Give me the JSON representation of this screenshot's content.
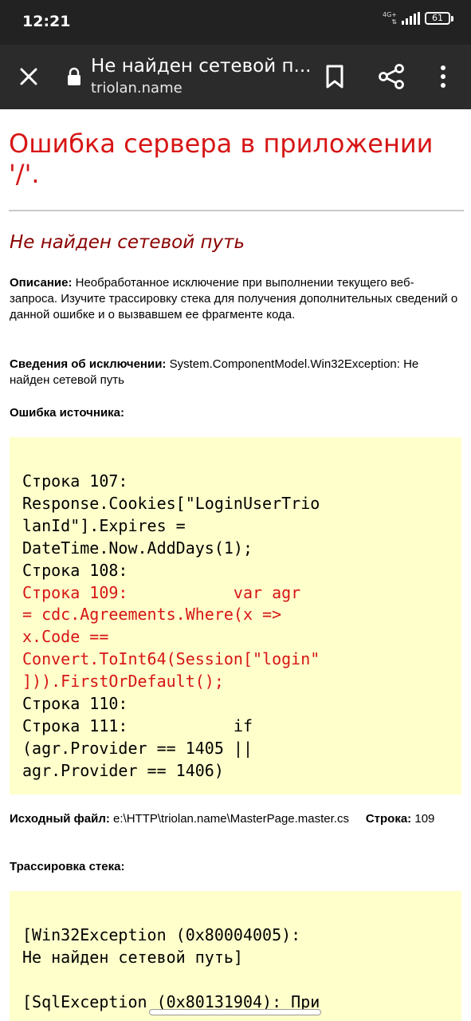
{
  "status_bar": {
    "time": "12:21",
    "network": "4G+",
    "battery": "61"
  },
  "browser": {
    "page_title": "Не найден сетевой п...",
    "url": "triolan.name"
  },
  "page": {
    "heading": "Ошибка сервера в приложении '/'.",
    "subheading": "Не найден сетевой путь",
    "description_label": "Описание:",
    "description_text": "Необработанное исключение при выполнении текущего веб-запроса. Изучите трассировку стека для получения дополнительных сведений о данной ошибке и о вызвавшем ее фрагменте кода.",
    "exception_label": "Сведения об исключении:",
    "exception_text": "System.ComponentModel.Win32Exception: Не найден сетевой путь",
    "source_error_label": "Ошибка источника:",
    "source_code_lines": [
      "Строка 107:",
      "Response.Cookies[\"LoginUserTrio",
      "lanId\"].Expires =",
      "DateTime.Now.AddDays(1);",
      "Строка 108:",
      "Строка 109:           var agr",
      "= cdc.Agreements.Where(x =>",
      "x.Code ==",
      "Convert.ToInt64(Session[\"login\"",
      "])).FirstOrDefault();",
      "Строка 110:",
      "Строка 111:           if",
      "(agr.Provider == 1405 ||",
      "agr.Provider == 1406)"
    ],
    "source_file_label": "Исходный файл:",
    "source_file_path": "e:\\HTTP\\triolan.name\\MasterPage.master.cs",
    "line_label": "Строка:",
    "line_number": "109",
    "stack_trace_label": "Трассировка стека:",
    "stack_trace_lines": [
      "[Win32Exception (0x80004005):",
      "Не найден сетевой путь]",
      "",
      "[SqlException (0x80131904): При"
    ]
  },
  "colors": {
    "error_heading": "#d71515",
    "subheading": "#8b0000",
    "code_background": "#ffffcc",
    "toolbar": "#2b2b2b"
  }
}
